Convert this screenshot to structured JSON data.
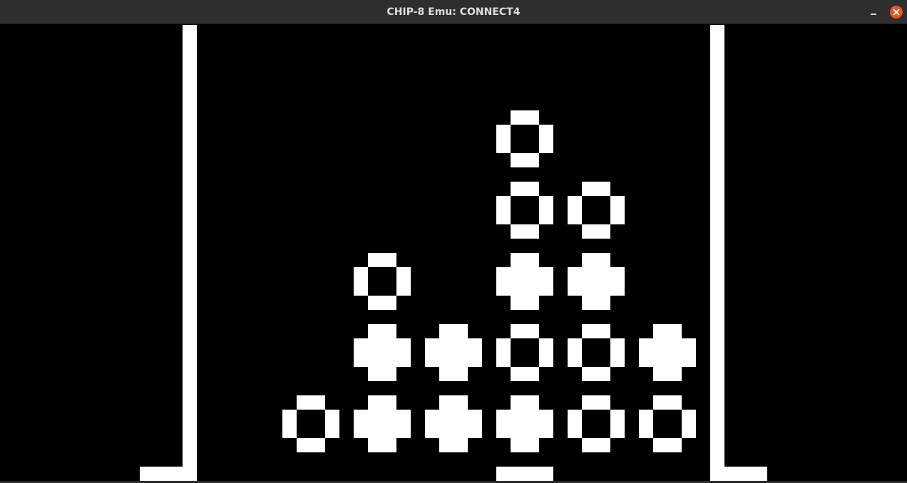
{
  "window": {
    "title": "CHIP-8 Emu: CONNECT4"
  },
  "icons": {
    "minimize": "minimize-icon",
    "close": "close-icon"
  },
  "colors": {
    "titlebar": "#2e2e2e",
    "screen_background": "#000000",
    "pixel_on": "#ffffff",
    "close_button": "#e95420"
  },
  "game": {
    "name": "CONNECT4",
    "display_resolution": "64x32",
    "board_columns": 7,
    "board_rows": 6,
    "cursor_column": 4,
    "pieces": [
      {
        "column": 1,
        "row": 1,
        "type": "hollow"
      },
      {
        "column": 2,
        "row": 1,
        "type": "filled"
      },
      {
        "column": 3,
        "row": 1,
        "type": "filled"
      },
      {
        "column": 4,
        "row": 1,
        "type": "filled"
      },
      {
        "column": 5,
        "row": 1,
        "type": "hollow"
      },
      {
        "column": 6,
        "row": 1,
        "type": "hollow"
      },
      {
        "column": 2,
        "row": 2,
        "type": "filled"
      },
      {
        "column": 3,
        "row": 2,
        "type": "filled"
      },
      {
        "column": 4,
        "row": 2,
        "type": "hollow"
      },
      {
        "column": 5,
        "row": 2,
        "type": "hollow"
      },
      {
        "column": 6,
        "row": 2,
        "type": "filled"
      },
      {
        "column": 2,
        "row": 3,
        "type": "hollow"
      },
      {
        "column": 4,
        "row": 3,
        "type": "filled"
      },
      {
        "column": 5,
        "row": 3,
        "type": "filled"
      },
      {
        "column": 4,
        "row": 4,
        "type": "hollow"
      },
      {
        "column": 5,
        "row": 4,
        "type": "hollow"
      },
      {
        "column": 4,
        "row": 5,
        "type": "hollow"
      }
    ]
  }
}
